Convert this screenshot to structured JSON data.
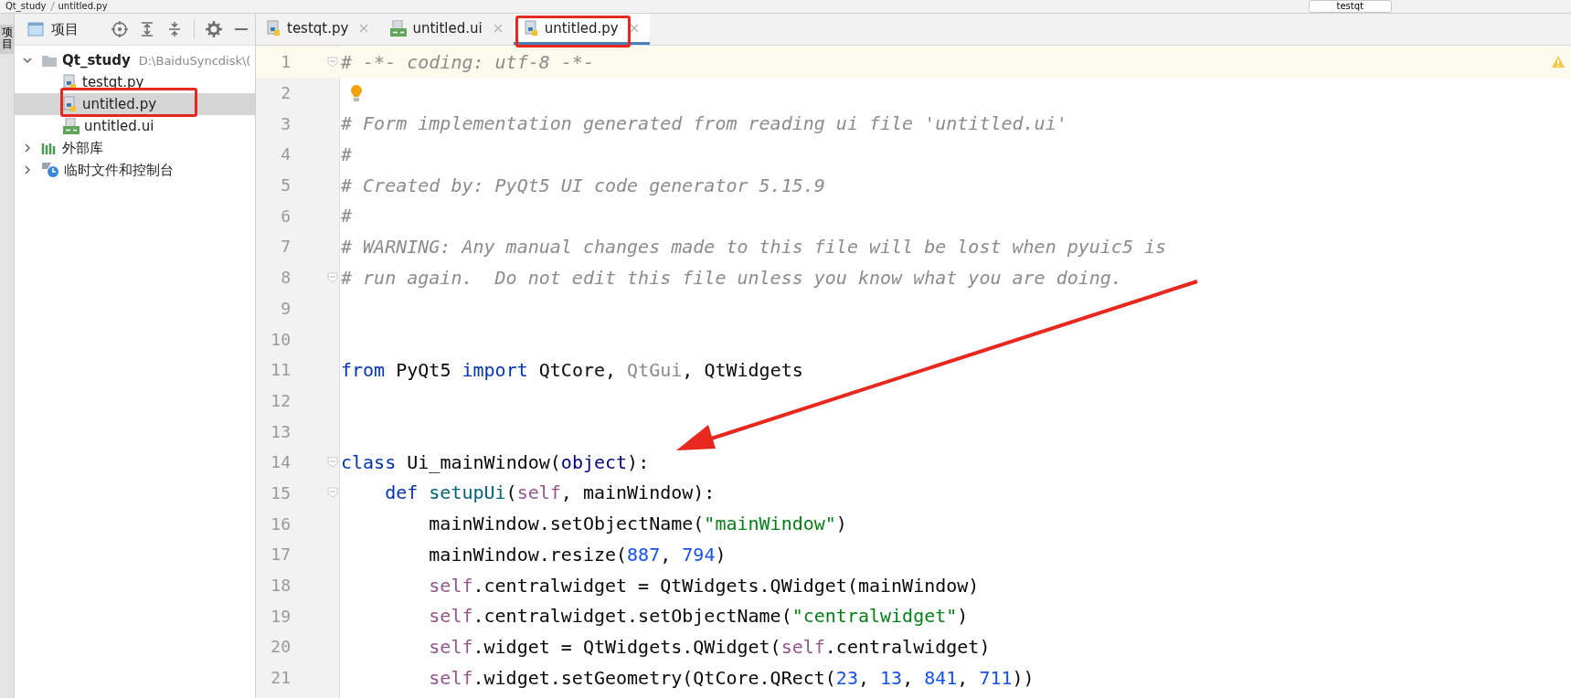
{
  "top_bar": {
    "breadcrumb": [
      "Qt_study",
      "untitled.py"
    ],
    "run_config": "testqt"
  },
  "side_strip": {
    "label": "项目"
  },
  "project_panel": {
    "title": "项目",
    "tree": [
      {
        "label": "Qt_study",
        "path": "D:\\BaiduSyncdisk\\(",
        "kind": "folder",
        "expanded": true,
        "selected": false,
        "children": [
          {
            "label": "testqt.py",
            "kind": "python",
            "selected": false
          },
          {
            "label": "untitled.py",
            "kind": "python",
            "selected": true
          },
          {
            "label": "untitled.ui",
            "kind": "ui",
            "selected": false
          }
        ]
      },
      {
        "label": "外部库",
        "kind": "library",
        "expanded": false,
        "selected": false
      },
      {
        "label": "临时文件和控制台",
        "kind": "scratch",
        "expanded": false,
        "selected": false
      }
    ]
  },
  "tabs": [
    {
      "label": "testqt.py",
      "kind": "python",
      "selected": false
    },
    {
      "label": "untitled.ui",
      "kind": "ui",
      "selected": false
    },
    {
      "label": "untitled.py",
      "kind": "python",
      "selected": true
    }
  ],
  "editor": {
    "lines": [
      {
        "number": "1",
        "current": true,
        "fold": true,
        "kind": "top",
        "tokens": [
          {
            "t": "# -*- coding: utf-8 -*-",
            "kind": "comment"
          }
        ]
      },
      {
        "number": "2",
        "current": false,
        "fold": false
      },
      {
        "number": "3",
        "current": false,
        "fold": false,
        "kind": "top",
        "tokens": [
          {
            "t": "# Form implementation generated from reading ui file 'untitled.ui'",
            "kind": "comment"
          }
        ]
      },
      {
        "number": "4",
        "current": false,
        "fold": false,
        "kind": "top",
        "tokens": [
          {
            "t": "#",
            "kind": "comment"
          }
        ]
      },
      {
        "number": "5",
        "current": false,
        "fold": false,
        "kind": "top",
        "tokens": [
          {
            "t": "# Created by: PyQt5 UI code generator 5.15.9",
            "kind": "comment"
          }
        ]
      },
      {
        "number": "6",
        "current": false,
        "fold": false,
        "kind": "top",
        "tokens": [
          {
            "t": "#",
            "kind": "comment"
          }
        ]
      },
      {
        "number": "7",
        "current": false,
        "fold": false,
        "kind": "top",
        "tokens": [
          {
            "t": "# WARNING: Any manual changes made to this file will be lost when pyuic5 is",
            "kind": "comment"
          }
        ]
      },
      {
        "number": "8",
        "current": false,
        "fold": true,
        "kind": "top",
        "tokens": [
          {
            "t": "# run again.  Do not edit this file unless you know what you are doing.",
            "kind": "comment"
          }
        ]
      },
      {
        "number": "9",
        "current": false,
        "fold": false
      },
      {
        "number": "10",
        "current": false,
        "fold": false
      },
      {
        "number": "11",
        "current": false,
        "fold": false,
        "kind": "top",
        "tokens": [
          {
            "t": "from",
            "kind": "keyword"
          },
          {
            "t": " PyQt5 ",
            "kind": "plain"
          },
          {
            "t": "import",
            "kind": "keyword"
          },
          {
            "t": " QtCore, ",
            "kind": "plain"
          },
          {
            "t": "QtGui",
            "kind": "unused"
          },
          {
            "t": ", QtWidgets",
            "kind": "plain"
          }
        ]
      },
      {
        "number": "12",
        "current": false,
        "fold": false
      },
      {
        "number": "13",
        "current": false,
        "fold": false
      },
      {
        "number": "14",
        "current": false,
        "fold": true,
        "kind": "top",
        "tokens": [
          {
            "t": "class",
            "kind": "keyword"
          },
          {
            "t": " Ui_mainWindow(",
            "kind": "plain"
          },
          {
            "t": "object",
            "kind": "builtin"
          },
          {
            "t": "):",
            "kind": "plain"
          }
        ]
      },
      {
        "number": "15",
        "current": false,
        "fold": true,
        "kind": "class",
        "tokens": [
          {
            "t": "def",
            "kind": "keyword"
          },
          {
            "t": " setupUi",
            "kind": "func"
          },
          {
            "t": "(",
            "kind": "plain"
          },
          {
            "t": "self",
            "kind": "self"
          },
          {
            "t": ", mainWindow):",
            "kind": "plain"
          }
        ]
      },
      {
        "number": "16",
        "current": false,
        "fold": false,
        "kind": "method",
        "tokens": [
          {
            "t": "mainWindow.setObjectName(",
            "kind": "plain"
          },
          {
            "t": "\"mainWindow\"",
            "kind": "string"
          },
          {
            "t": ")",
            "kind": "plain"
          }
        ]
      },
      {
        "number": "17",
        "current": false,
        "fold": false,
        "kind": "method",
        "tokens": [
          {
            "t": "mainWindow.resize(",
            "kind": "plain"
          },
          {
            "t": "887",
            "kind": "number"
          },
          {
            "t": ", ",
            "kind": "plain"
          },
          {
            "t": "794",
            "kind": "number"
          },
          {
            "t": ")",
            "kind": "plain"
          }
        ]
      },
      {
        "number": "18",
        "current": false,
        "fold": false,
        "kind": "method",
        "tokens": [
          {
            "t": "self",
            "kind": "self"
          },
          {
            "t": ".centralwidget = QtWidgets.QWidget(mainWindow)",
            "kind": "plain"
          }
        ]
      },
      {
        "number": "19",
        "current": false,
        "fold": false,
        "kind": "method",
        "tokens": [
          {
            "t": "self",
            "kind": "self"
          },
          {
            "t": ".centralwidget.setObjectName(",
            "kind": "plain"
          },
          {
            "t": "\"centralwidget\"",
            "kind": "string"
          },
          {
            "t": ")",
            "kind": "plain"
          }
        ]
      },
      {
        "number": "20",
        "current": false,
        "fold": false,
        "kind": "method",
        "tokens": [
          {
            "t": "self",
            "kind": "self"
          },
          {
            "t": ".widget = QtWidgets.QWidget(",
            "kind": "plain"
          },
          {
            "t": "self",
            "kind": "self"
          },
          {
            "t": ".centralwidget)",
            "kind": "plain"
          }
        ]
      },
      {
        "number": "21",
        "current": false,
        "fold": false,
        "kind": "method",
        "tokens": [
          {
            "t": "self",
            "kind": "self"
          },
          {
            "t": ".widget.setGeometry(QtCore.QRect(",
            "kind": "plain"
          },
          {
            "t": "23",
            "kind": "number"
          },
          {
            "t": ", ",
            "kind": "plain"
          },
          {
            "t": "13",
            "kind": "number"
          },
          {
            "t": ", ",
            "kind": "plain"
          },
          {
            "t": "841",
            "kind": "number"
          },
          {
            "t": ", ",
            "kind": "plain"
          },
          {
            "t": "711",
            "kind": "number"
          },
          {
            "t": "))",
            "kind": "plain"
          }
        ]
      }
    ]
  }
}
